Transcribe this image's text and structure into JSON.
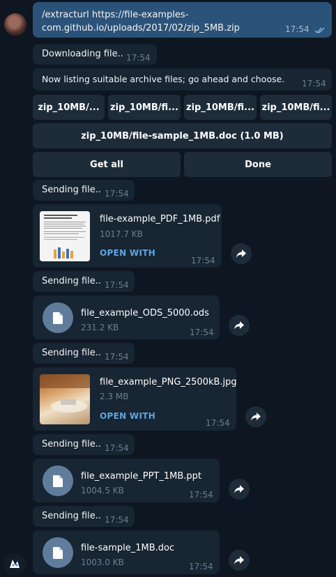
{
  "command": {
    "line1": "/extracturl https://file-examples-",
    "line2": "com.github.io/uploads/2017/02/zip_5MB.zip",
    "time": "17:54"
  },
  "downloading": {
    "text": "Downloading file..",
    "time": "17:54"
  },
  "listing": {
    "text": "Now listing suitable archive files; go ahead and choose.",
    "time": "17:54"
  },
  "keyboard": {
    "row1": [
      "zip_10MB/...",
      "zip_10MB/fi...",
      "zip_10MB/fi...",
      "zip_10MB/fi..."
    ],
    "row2": "zip_10MB/file-sample_1MB.doc (1.0 MB)",
    "get_all": "Get all",
    "done": "Done"
  },
  "sending": {
    "text": "Sending file..",
    "time": "17:54"
  },
  "files": [
    {
      "name": "file-example_PDF_1MB.pdf",
      "size": "1017.7 KB",
      "time": "17:54",
      "action": "OPEN WITH",
      "thumb": "pdf-thumbnail"
    },
    {
      "name": "file_example_ODS_5000.ods",
      "size": "231.2 KB",
      "time": "17:54",
      "icon": "document-icon"
    },
    {
      "name": "file_example_PNG_2500kB.jpg",
      "size": "2.3 MB",
      "time": "17:54",
      "action": "OPEN WITH",
      "thumb": "photo-thumbnail"
    },
    {
      "name": "file_example_PPT_1MB.ppt",
      "size": "1004.5 KB",
      "time": "17:54",
      "icon": "document-icon"
    },
    {
      "name": "file-sample_1MB.doc",
      "size": "1003.0 KB",
      "time": "17:54",
      "icon": "document-icon"
    }
  ],
  "colors": {
    "background": "#0e1621",
    "incoming": "#182533",
    "outgoing": "#2b5278",
    "accent": "#5ea6e0"
  }
}
